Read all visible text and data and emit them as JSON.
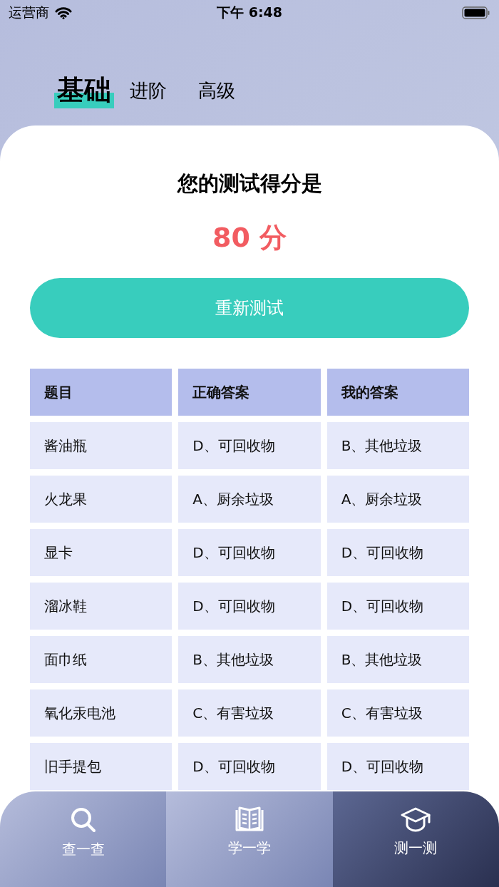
{
  "status_bar": {
    "carrier": "运营商",
    "time": "下午 6:48"
  },
  "level_tabs": [
    {
      "label": "基础",
      "selected": true
    },
    {
      "label": "进阶",
      "selected": false
    },
    {
      "label": "高级",
      "selected": false
    }
  ],
  "result": {
    "title": "您的测试得分是",
    "score": "80 分",
    "retry_button": "重新测试"
  },
  "table": {
    "columns": [
      "题目",
      "正确答案",
      "我的答案"
    ],
    "rows": [
      [
        "酱油瓶",
        "D、可回收物",
        "B、其他垃圾"
      ],
      [
        "火龙果",
        "A、厨余垃圾",
        "A、厨余垃圾"
      ],
      [
        "显卡",
        "D、可回收物",
        "D、可回收物"
      ],
      [
        "溜冰鞋",
        "D、可回收物",
        "D、可回收物"
      ],
      [
        "面巾纸",
        "B、其他垃圾",
        "B、其他垃圾"
      ],
      [
        "氧化汞电池",
        "C、有害垃圾",
        "C、有害垃圾"
      ],
      [
        "旧手提包",
        "D、可回收物",
        "D、可回收物"
      ]
    ]
  },
  "tab_bar": [
    {
      "label": "查一查",
      "kind": "search",
      "selected": false
    },
    {
      "label": "学一学",
      "kind": "book",
      "selected": false
    },
    {
      "label": "测一测",
      "kind": "cap",
      "selected": true
    }
  ]
}
